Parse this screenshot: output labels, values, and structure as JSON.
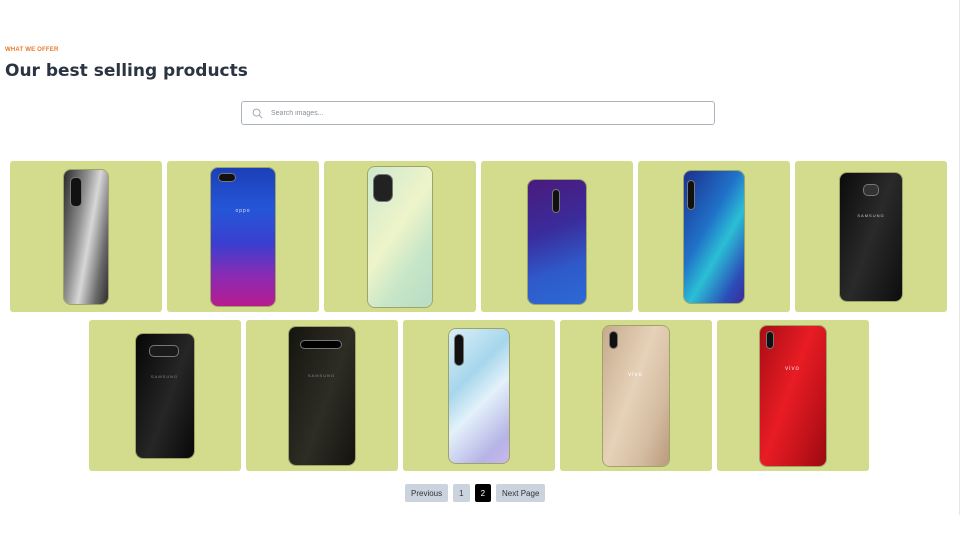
{
  "section": {
    "eyebrow": "WHAT WE OFFER",
    "title": "Our best selling products"
  },
  "search": {
    "placeholder": "Search images..."
  },
  "products": [
    {
      "name": "oppo-grey-quad-cam"
    },
    {
      "name": "oppo-blue-purple"
    },
    {
      "name": "realme-mint"
    },
    {
      "name": "realme-purple"
    },
    {
      "name": "realme-teal"
    },
    {
      "name": "samsung-black"
    },
    {
      "name": "samsung-s8-black"
    },
    {
      "name": "samsung-s10-black"
    },
    {
      "name": "vivo-light-blue"
    },
    {
      "name": "vivo-gold"
    },
    {
      "name": "vivo-red"
    }
  ],
  "brands": {
    "oppo": "oppo",
    "samsung": "SAMSUNG",
    "vivo": "vivo"
  },
  "pagination": {
    "previous": "Previous",
    "page1": "1",
    "page2": "2",
    "next": "Next Page",
    "current": 2
  },
  "colors": {
    "accent": "#e8792b",
    "card_bg": "#d3db8d",
    "active_page": "#000000",
    "button_bg": "#cbd3df"
  }
}
